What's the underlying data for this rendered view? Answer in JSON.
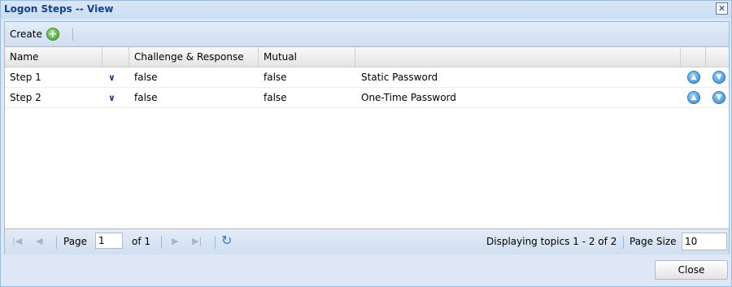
{
  "window": {
    "title": "Logon Steps -- View",
    "close_glyph": "✕"
  },
  "toolbar": {
    "create_label": "Create",
    "create_icon": "plus-icon"
  },
  "grid": {
    "columns": [
      "Name",
      "",
      "Challenge & Response",
      "Mutual",
      "",
      "",
      ""
    ],
    "rows": [
      {
        "name": "Step 1",
        "challenge_response": "false",
        "mutual": "false",
        "method": "Static Password"
      },
      {
        "name": "Step 2",
        "challenge_response": "false",
        "mutual": "false",
        "method": "One-Time Password"
      }
    ]
  },
  "pager": {
    "page_label": "Page",
    "page_value": "1",
    "of_label": "of 1",
    "display_text": "Displaying topics 1 - 2 of 2",
    "page_size_label": "Page Size",
    "page_size_value": "10"
  },
  "footer": {
    "close_label": "Close"
  },
  "colors": {
    "title": "#15428b",
    "border": "#99bbe8",
    "accent": "#2f86d6"
  }
}
